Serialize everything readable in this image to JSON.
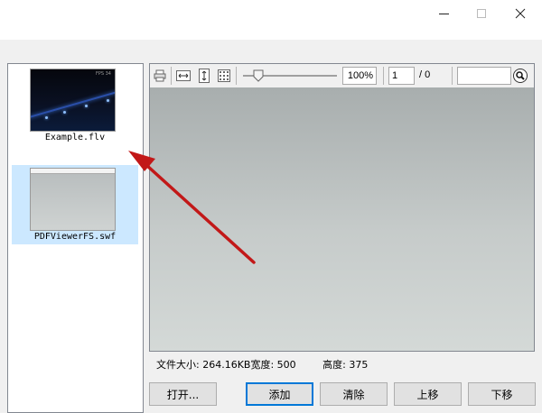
{
  "window": {
    "controls": [
      "minimize-icon",
      "maximize-icon",
      "close-icon"
    ]
  },
  "file_list": {
    "items": [
      {
        "label": "Example.flv",
        "thumb_text": "FPS 34",
        "selected": false
      },
      {
        "label": "PDFViewerFS.swf",
        "selected": true
      }
    ]
  },
  "viewer": {
    "toolbar_icons": [
      "print-icon",
      "fit-width-icon",
      "fit-height-icon",
      "thumbnails-icon",
      "zoom-slider",
      "search-icon"
    ],
    "zoom_value": "100%",
    "page_value": "1",
    "page_total": "/ 0",
    "search_value": "",
    "colors": {
      "page_top": "#a8aeae",
      "page_bottom": "#d4d9d7"
    }
  },
  "file_info": {
    "size": "文件大小: 264.16KB",
    "width": "宽度: 500",
    "height": "高度: 375"
  },
  "buttons": {
    "open": "打开...",
    "add": "添加",
    "remove": "清除",
    "move_up": "上移",
    "move_down": "下移"
  },
  "annotation": {
    "arrow_color": "#d9201e"
  }
}
